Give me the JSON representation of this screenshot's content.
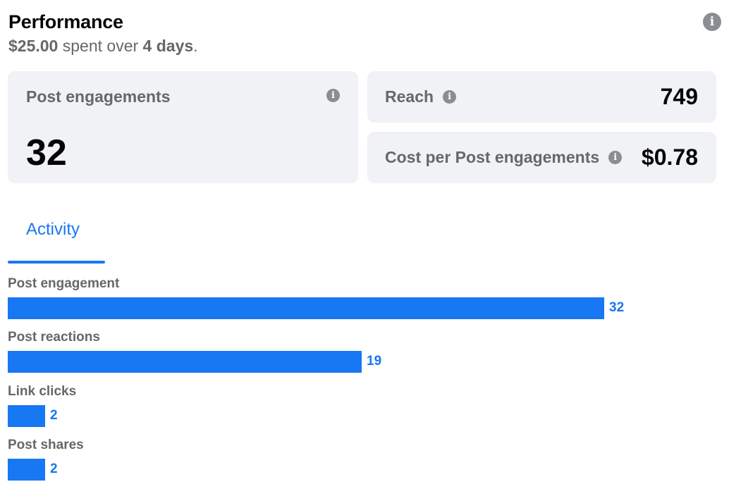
{
  "header": {
    "title": "Performance",
    "spent_amount": "$25.00",
    "spent_text": " spent over ",
    "duration": "4 days",
    "period": "."
  },
  "cards": {
    "post_engagements": {
      "label": "Post engagements",
      "value": "32"
    },
    "reach": {
      "label": "Reach",
      "value": "749"
    },
    "cost_per_engagement": {
      "label": "Cost per Post engagements",
      "value": "$0.78"
    }
  },
  "icons": {
    "info": "info-icon"
  },
  "tabs": {
    "activity": "Activity"
  },
  "colors": {
    "accent": "#1877f2",
    "card_bg": "#f0f2f5",
    "label_gray": "#65676b",
    "icon_gray": "#8a8d91"
  },
  "chart_data": {
    "type": "bar",
    "orientation": "horizontal",
    "categories": [
      "Post engagement",
      "Post reactions",
      "Link clicks",
      "Post shares"
    ],
    "values": [
      32,
      19,
      2,
      2
    ],
    "value_labels": [
      "32",
      "19",
      "2",
      "2"
    ],
    "xlim": [
      0,
      32
    ]
  }
}
